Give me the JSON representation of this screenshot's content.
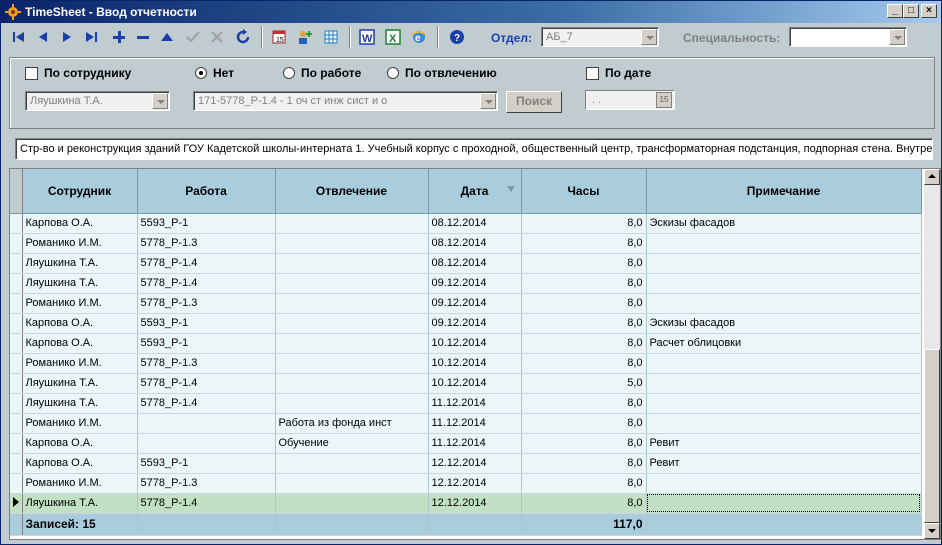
{
  "window": {
    "title": "TimeSheet - Ввод отчетности"
  },
  "toolbar": {
    "dept_label": "Отдел:",
    "dept_value": "АБ_7",
    "spec_label": "Специальность:",
    "spec_value": ""
  },
  "filter": {
    "by_employee": "По сотруднику",
    "none": "Нет",
    "by_work": "По работе",
    "by_absence": "По отвлечению",
    "by_date": "По дате",
    "employee_value": "Ляушкина Т.А.",
    "work_value": "171-5778_Р-1.4 - 1 оч ст инж сист и о",
    "search_label": "Поиск",
    "date_value": ". ."
  },
  "description": "Стр-во и реконструкция зданий ГОУ Кадетской школы-интерната 1. Учебный корпус с проходной, общественный центр, трансформаторная подстанция, подпорная стена. Внутре",
  "grid": {
    "columns": [
      "Сотрудник",
      "Работа",
      "Отвлечение",
      "Дата",
      "Часы",
      "Примечание"
    ],
    "rows": [
      {
        "employee": "Карпова О.А.",
        "work": "5593_Р-1",
        "absence": "",
        "date": "08.12.2014",
        "hours": "8,0",
        "note": "Эскизы фасадов"
      },
      {
        "employee": "Романико И.М.",
        "work": "5778_Р-1.3",
        "absence": "",
        "date": "08.12.2014",
        "hours": "8,0",
        "note": ""
      },
      {
        "employee": "Ляушкина Т.А.",
        "work": "5778_Р-1.4",
        "absence": "",
        "date": "08.12.2014",
        "hours": "8,0",
        "note": ""
      },
      {
        "employee": "Ляушкина Т.А.",
        "work": "5778_Р-1.4",
        "absence": "",
        "date": "09.12.2014",
        "hours": "8,0",
        "note": ""
      },
      {
        "employee": "Романико И.М.",
        "work": "5778_Р-1.3",
        "absence": "",
        "date": "09.12.2014",
        "hours": "8,0",
        "note": ""
      },
      {
        "employee": "Карпова О.А.",
        "work": "5593_Р-1",
        "absence": "",
        "date": "09.12.2014",
        "hours": "8,0",
        "note": "Эскизы фасадов"
      },
      {
        "employee": "Карпова О.А.",
        "work": "5593_Р-1",
        "absence": "",
        "date": "10.12.2014",
        "hours": "8,0",
        "note": "Расчет облицовки"
      },
      {
        "employee": "Романико И.М.",
        "work": "5778_Р-1.3",
        "absence": "",
        "date": "10.12.2014",
        "hours": "8,0",
        "note": ""
      },
      {
        "employee": "Ляушкина Т.А.",
        "work": "5778_Р-1.4",
        "absence": "",
        "date": "10.12.2014",
        "hours": "5,0",
        "note": ""
      },
      {
        "employee": "Ляушкина Т.А.",
        "work": "5778_Р-1.4",
        "absence": "",
        "date": "11.12.2014",
        "hours": "8,0",
        "note": ""
      },
      {
        "employee": "Романико И.М.",
        "work": "",
        "absence": "Работа из фонда инст",
        "date": "11.12.2014",
        "hours": "8,0",
        "note": ""
      },
      {
        "employee": "Карпова О.А.",
        "work": "",
        "absence": "Обучение",
        "date": "11.12.2014",
        "hours": "8,0",
        "note": "Ревит"
      },
      {
        "employee": "Карпова О.А.",
        "work": "5593_Р-1",
        "absence": "",
        "date": "12.12.2014",
        "hours": "8,0",
        "note": "Ревит"
      },
      {
        "employee": "Романико И.М.",
        "work": "5778_Р-1.3",
        "absence": "",
        "date": "12.12.2014",
        "hours": "8,0",
        "note": ""
      },
      {
        "employee": "Ляушкина Т.А.",
        "work": "5778_Р-1.4",
        "absence": "",
        "date": "12.12.2014",
        "hours": "8,0",
        "note": "",
        "selected": true
      }
    ],
    "footer": {
      "records": "Записей: 15",
      "total_hours": "117,0"
    }
  },
  "icons": [
    "first-icon",
    "prev-icon",
    "next-icon",
    "last-icon",
    "add-icon",
    "delete-icon",
    "edit-icon",
    "post-icon",
    "cancel-icon",
    "refresh-icon",
    "calendar-icon",
    "add-user-icon",
    "table-icon",
    "word-icon",
    "excel-icon",
    "ie-icon",
    "help-icon"
  ],
  "colors": {
    "header_bg": "#a9cddd",
    "row_bg": "#eaf6f8",
    "selected_row_bg": "#c1e0c4",
    "toolbar_icon": "#1a3fa8"
  }
}
